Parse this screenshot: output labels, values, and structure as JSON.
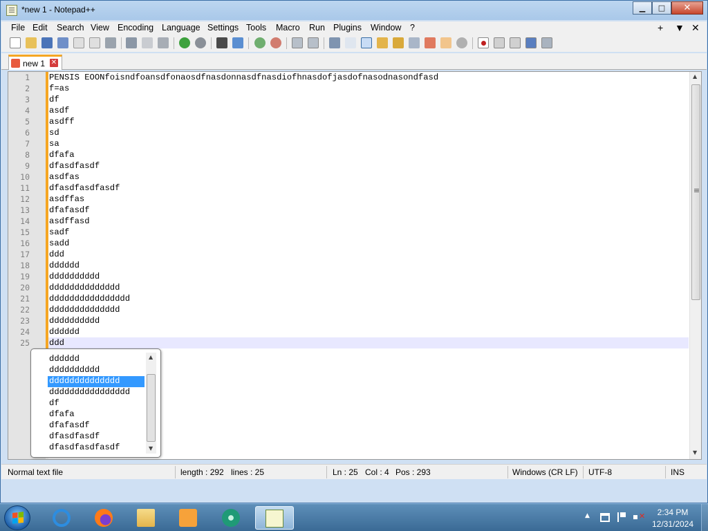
{
  "window": {
    "title": "*new 1 - Notepad++",
    "min_glyph": "▁",
    "max_glyph": "□",
    "close_glyph": "✕"
  },
  "menu": {
    "items": [
      "File",
      "Edit",
      "Search",
      "View",
      "Encoding",
      "Language",
      "Settings",
      "Tools",
      "Macro",
      "Run",
      "Plugins",
      "Window",
      "?"
    ],
    "right": [
      "+",
      "▼",
      "✕"
    ]
  },
  "tab": {
    "label": "new 1",
    "close_glyph": "✕"
  },
  "editor": {
    "line_numbers": [
      "1",
      "2",
      "3",
      "4",
      "5",
      "6",
      "7",
      "8",
      "9",
      "10",
      "11",
      "12",
      "13",
      "14",
      "15",
      "16",
      "17",
      "18",
      "19",
      "20",
      "21",
      "22",
      "23",
      "24",
      "25"
    ],
    "lines": [
      "PENSIS EOONfoisndfoansdfonaosdfnasdonnasdfnasdiofhnasdofjasdofnasodnasondfasd",
      "f=as",
      "df",
      "asdf",
      "asdff",
      "sd",
      "sa",
      "dfafa",
      "dfasdfasdf",
      "asdfas",
      "dfasdfasdfasdf",
      "asdffas",
      "dfafasdf",
      "asdffasd",
      "sadf",
      "sadd",
      "ddd",
      "dddddd",
      "dddddddddd",
      "dddddddddddddd",
      "dddddddddddddddd",
      "dddddddddddddd",
      "dddddddddd",
      "dddddd",
      "ddd"
    ],
    "current_line": 25
  },
  "autocomplete": {
    "items": [
      "dddddd",
      "dddddddddd",
      "dddddddddddddd",
      "dddddddddddddddd",
      "df",
      "dfafa",
      "dfafasdf",
      "dfasdfasdf",
      "dfasdfasdfasdf"
    ],
    "selected_index": 2
  },
  "status": {
    "type": "Normal text file",
    "length": "length : 292",
    "lines": "lines : 25",
    "ln": "Ln : 25",
    "col": "Col : 4",
    "pos": "Pos : 293",
    "eol": "Windows (CR LF)",
    "encoding": "UTF-8",
    "mode": "INS"
  },
  "taskbar": {
    "apps": [
      "start-button",
      "internet-explorer",
      "firefox",
      "file-explorer",
      "media-player",
      "app-green",
      "notepad-plus-plus"
    ],
    "time": "2:34 PM",
    "date": "12/31/2024",
    "tray_show_glyph": "▲"
  },
  "colors": {
    "accent": "#f5a623",
    "selection": "#3399ff",
    "current_line": "#e8e8ff"
  }
}
